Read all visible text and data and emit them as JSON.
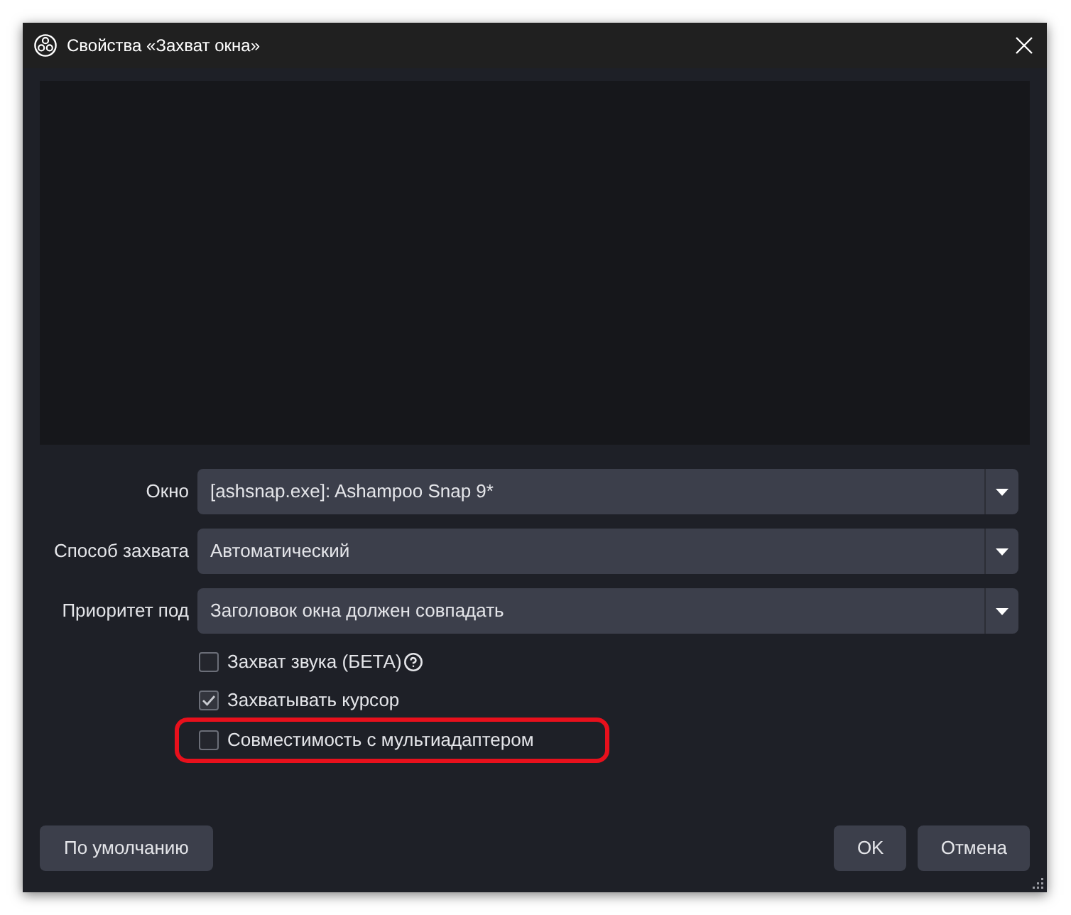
{
  "window": {
    "title": "Свойства «Захват окна»"
  },
  "fields": [
    {
      "label": "Окно",
      "value": "[ashsnap.exe]: Ashampoo Snap 9*"
    },
    {
      "label": "Способ захвата",
      "value": "Автоматический"
    },
    {
      "label": "Приоритет под",
      "value": "Заголовок окна должен совпадать"
    }
  ],
  "checkboxes": [
    {
      "label": "Захват звука (БЕТА)",
      "checked": false,
      "help": true,
      "highlighted": false
    },
    {
      "label": "Захватывать курсор",
      "checked": true,
      "help": false,
      "highlighted": false
    },
    {
      "label": "Совместимость с мультиадаптером",
      "checked": false,
      "help": false,
      "highlighted": true
    }
  ],
  "footer": {
    "left_buttons": [
      "По умолчанию"
    ],
    "right_buttons": [
      "OK",
      "Отмена"
    ]
  }
}
